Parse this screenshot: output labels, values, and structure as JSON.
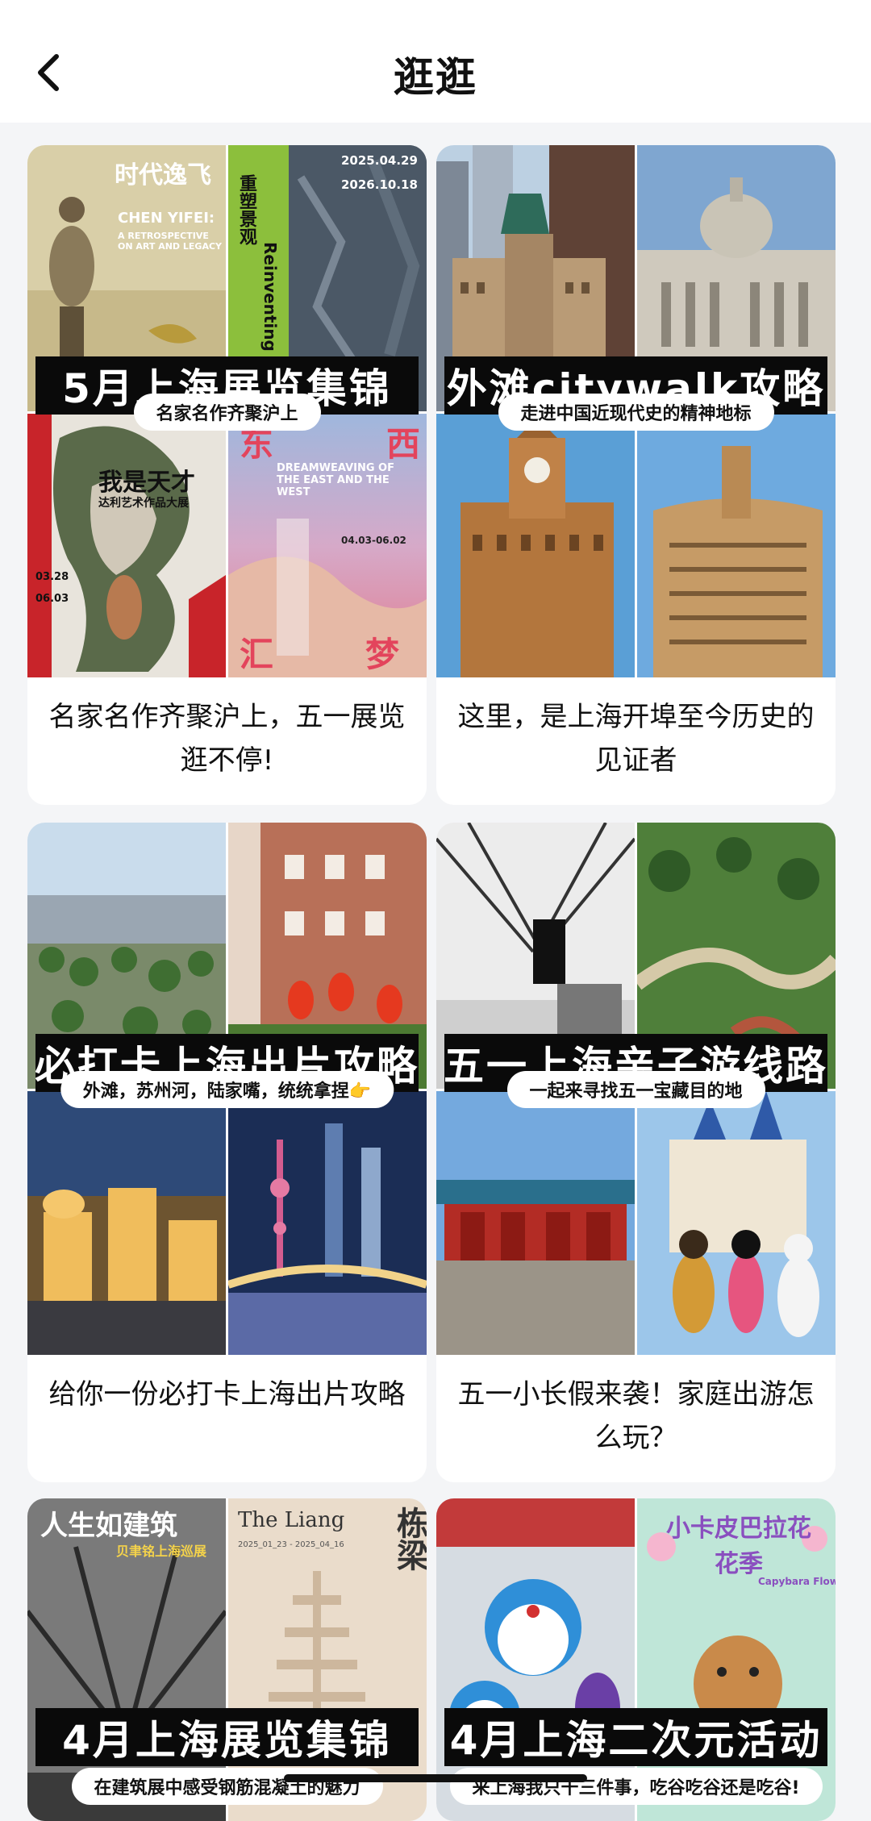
{
  "header": {
    "title": "逛逛",
    "back_icon": "chevron-left-icon"
  },
  "cards": [
    {
      "cover_title": "5月上海展览集锦",
      "cover_subtitle": "名家名作齐聚沪上",
      "caption": "名家名作齐聚沪上，五一展览逛不停!",
      "poster_texts": {
        "p1_title": "时代逸飞",
        "p1_name": "CHEN YIFEI:",
        "p1_sub": "A RETROSPECTIVE ON ART AND LEGACY",
        "p2_title": "重塑景观",
        "p2_dates_1": "2025.04.29",
        "p2_dates_2": "2026.10.18",
        "p2_vertical": "Reinventing",
        "p3_title": "我是天才",
        "p3_sub": "达利艺术作品大展",
        "p3_date_1": "03.28",
        "p3_date_2": "06.03",
        "p4_big_1": "东",
        "p4_big_2": "西",
        "p4_text": "DREAMWEAVING OF THE EAST AND THE WEST",
        "p4_date": "04.03-06.02",
        "p4_big_3": "汇",
        "p4_big_4": "梦"
      }
    },
    {
      "cover_title": "外滩citywalk攻略",
      "cover_subtitle": "走进中国近现代史的精神地标",
      "caption": "这里，是上海开埠至今历史的见证者"
    },
    {
      "cover_title": "必打卡上海出片攻略",
      "cover_subtitle": "外滩，苏州河，陆家嘴，统统拿捏👉",
      "caption": "给你一份必打卡上海出片攻略"
    },
    {
      "cover_title": "五一上海亲子游线路",
      "cover_subtitle": "一起来寻找五一宝藏目的地",
      "caption": "五一小长假来袭！家庭出游怎么玩？"
    },
    {
      "cover_title": "4月上海展览集锦",
      "cover_subtitle": "在建筑展中感受钢筋混凝土的魅力",
      "poster_texts": {
        "p1_title": "人生如建筑",
        "p1_sub": "贝聿铭上海巡展",
        "p2_title": "The Liang",
        "p2_dates": "2025_01_23 - 2025_04_16",
        "p2_big": "栋梁"
      }
    },
    {
      "cover_title": "4月上海二次元活动",
      "cover_subtitle": "来上海我只干三件事，吃谷吃谷还是吃谷!",
      "poster_texts": {
        "p2_title": "小卡皮巴拉花花季",
        "p2_sub": "Capybara Flower"
      }
    }
  ],
  "colors": {
    "background": "#f4f5f7",
    "card": "#ffffff",
    "cover_bar": "#0a0a0a"
  }
}
